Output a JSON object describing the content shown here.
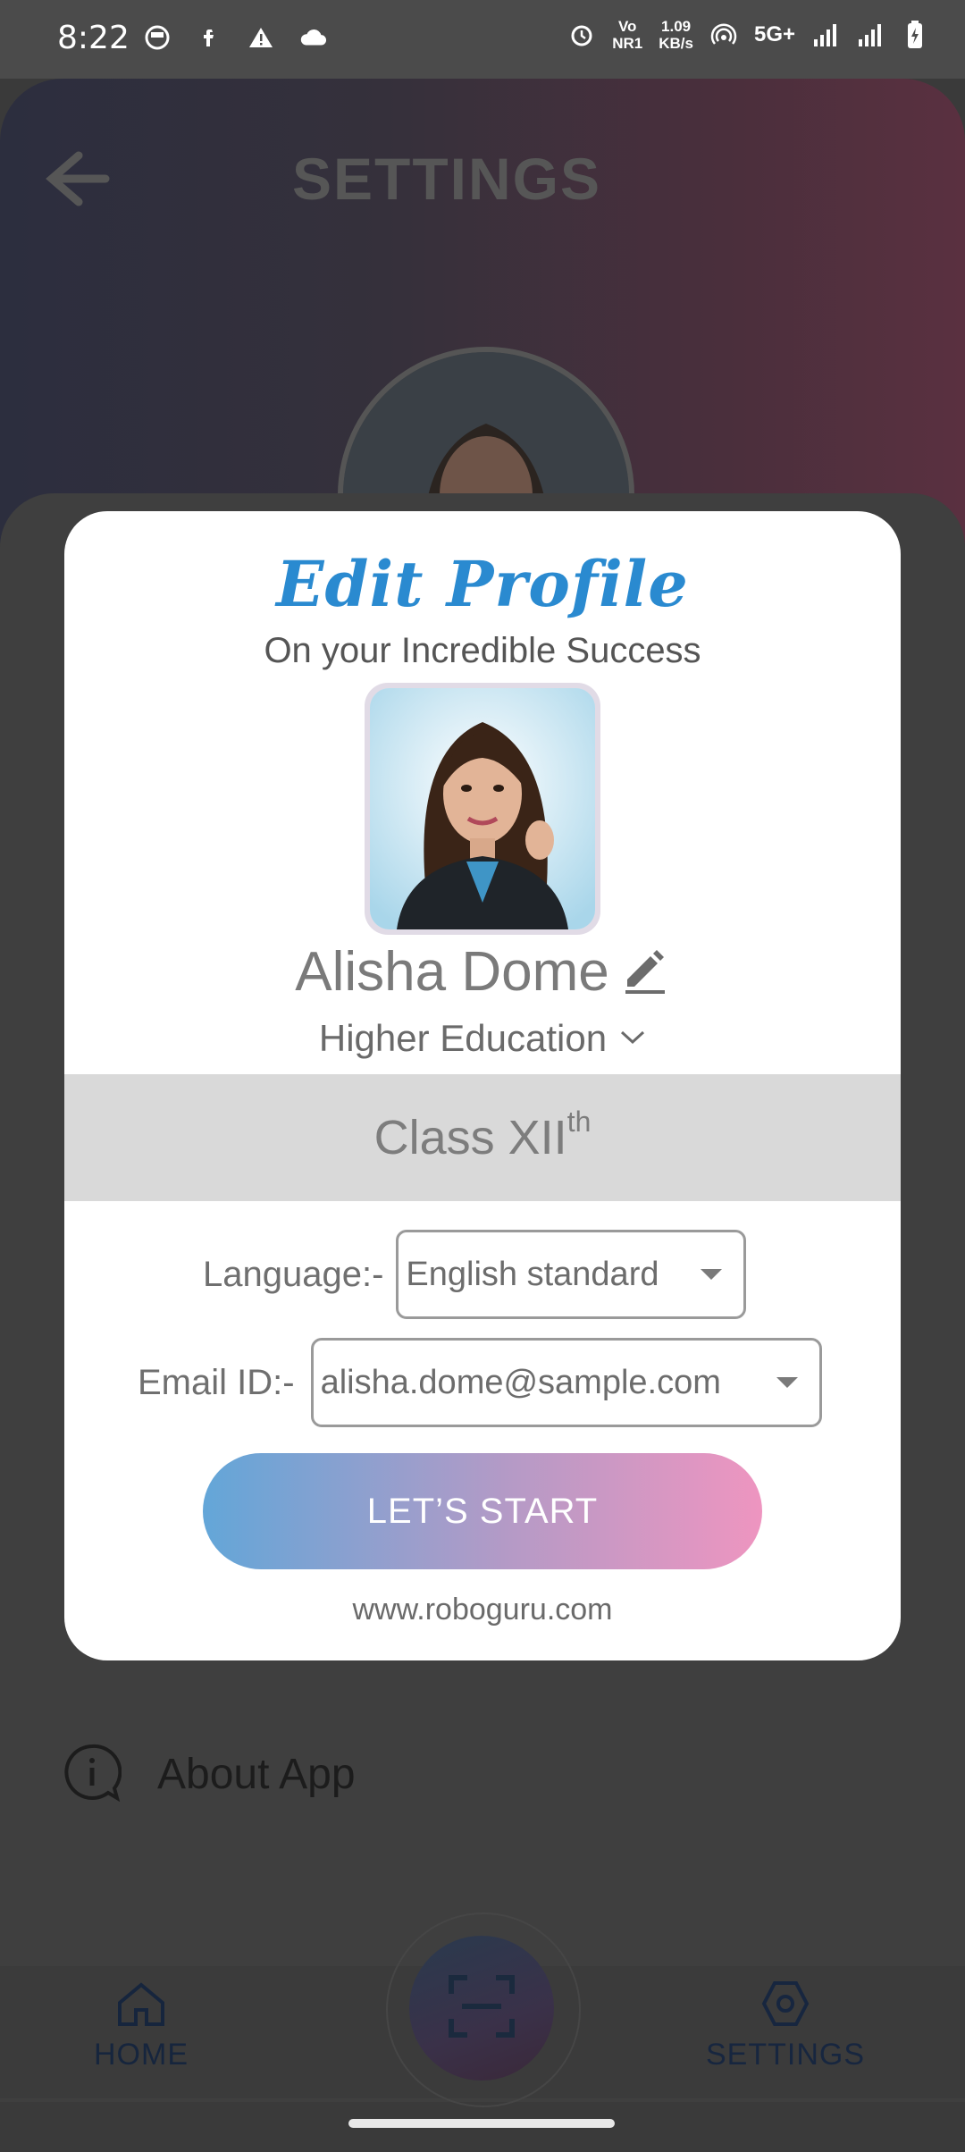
{
  "status_bar": {
    "time": "8:22",
    "network": "5G+",
    "speed_top": "1.09",
    "speed_bottom": "KB/s",
    "vo_top": "Vo",
    "vo_bottom": "NR1"
  },
  "header": {
    "title": "SETTINGS"
  },
  "menu": {
    "about_label": "About App"
  },
  "bottom_nav": {
    "home_label": "HOME",
    "settings_label": "SETTINGS"
  },
  "modal": {
    "title": "Edit Profile",
    "subtitle": "On your Incredible Success",
    "user_name": "Alisha Dome",
    "education": "Higher Education",
    "class_main": "Class XII",
    "class_sup": "th",
    "language_label": "Language:-",
    "language_value": "English standard",
    "email_label": "Email ID:-",
    "email_value": "alisha.dome@sample.com",
    "start_button": "LET’S START",
    "website": "www.roboguru.com"
  },
  "colors": {
    "accent_blue": "#2a8ad0",
    "button_gradient_start": "#63a6d8",
    "button_gradient_end": "#ee95c0"
  }
}
